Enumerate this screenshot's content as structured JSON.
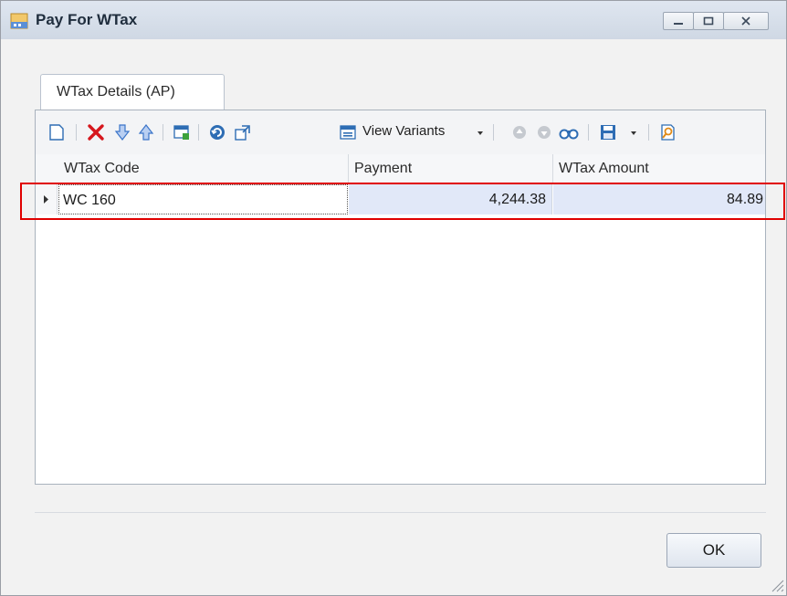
{
  "window": {
    "title": "Pay For WTax"
  },
  "tabs": [
    {
      "label": "WTax Details (AP)"
    }
  ],
  "toolbar": {
    "view_variants_label": "View Variants"
  },
  "grid": {
    "columns": [
      "WTax Code",
      "Payment",
      "WTax Amount"
    ],
    "rows": [
      {
        "wtax_code": "WC 160",
        "payment": "4,244.38",
        "wtax_amount": "84.89"
      }
    ]
  },
  "footer": {
    "ok_label": "OK"
  },
  "colors": {
    "highlight_box": "#e00000",
    "selected_cell": "#e1e8f8"
  }
}
